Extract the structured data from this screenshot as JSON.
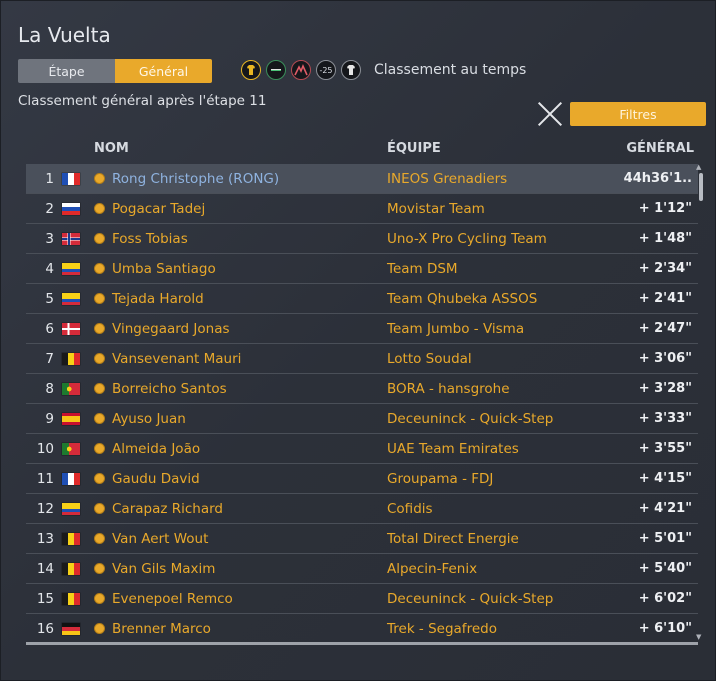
{
  "title": "La Vuelta",
  "segment": {
    "etape": "Étape",
    "general": "Général",
    "selected": "general"
  },
  "icons": [
    {
      "name": "yellow-jersey-icon",
      "color": "#e8b623"
    },
    {
      "name": "green-jersey-icon",
      "color": "#3a8f5a"
    },
    {
      "name": "mountain-jersey-icon",
      "color": "#b44a52"
    },
    {
      "name": "young-rider-icon",
      "text": "-25"
    },
    {
      "name": "team-jersey-icon",
      "color": "#e5e5e5"
    }
  ],
  "classification_label": "Classement au temps",
  "subtitle": "Classement général après l'étape 11",
  "filters_label": "Filtres",
  "columns": {
    "nom": "NOM",
    "equipe": "ÉQUIPE",
    "general": "GÉNÉRAL"
  },
  "rows": [
    {
      "rank": "1",
      "flag": "fr",
      "name": "Rong Christophe (RONG)",
      "team": "INEOS Grenadiers",
      "gap": "44h36'1..",
      "selected": true
    },
    {
      "rank": "2",
      "flag": "si",
      "name": "Pogacar Tadej",
      "team": "Movistar Team",
      "gap": "+ 1'12\""
    },
    {
      "rank": "3",
      "flag": "no",
      "name": "Foss Tobias",
      "team": "Uno-X Pro Cycling Team",
      "gap": "+ 1'48\""
    },
    {
      "rank": "4",
      "flag": "co",
      "name": "Umba Santiago",
      "team": "Team DSM",
      "gap": "+ 2'34\""
    },
    {
      "rank": "5",
      "flag": "co",
      "name": "Tejada Harold",
      "team": "Team Qhubeka ASSOS",
      "gap": "+ 2'41\""
    },
    {
      "rank": "6",
      "flag": "dk",
      "name": "Vingegaard Jonas",
      "team": "Team Jumbo - Visma",
      "gap": "+ 2'47\""
    },
    {
      "rank": "7",
      "flag": "be",
      "name": "Vansevenant Mauri",
      "team": "Lotto Soudal",
      "gap": "+ 3'06\""
    },
    {
      "rank": "8",
      "flag": "pt",
      "name": "Borreicho Santos",
      "team": "BORA - hansgrohe",
      "gap": "+ 3'28\""
    },
    {
      "rank": "9",
      "flag": "es",
      "name": "Ayuso Juan",
      "team": "Deceuninck - Quick-Step",
      "gap": "+ 3'33\""
    },
    {
      "rank": "10",
      "flag": "pt",
      "name": "Almeida João",
      "team": "UAE Team Emirates",
      "gap": "+ 3'55\""
    },
    {
      "rank": "11",
      "flag": "fr",
      "name": "Gaudu David",
      "team": "Groupama - FDJ",
      "gap": "+ 4'15\""
    },
    {
      "rank": "12",
      "flag": "ec",
      "name": "Carapaz Richard",
      "team": "Cofidis",
      "gap": "+ 4'21\""
    },
    {
      "rank": "13",
      "flag": "be",
      "name": "Van Aert Wout",
      "team": "Total Direct Energie",
      "gap": "+ 5'01\""
    },
    {
      "rank": "14",
      "flag": "be",
      "name": "Van Gils Maxim",
      "team": "Alpecin-Fenix",
      "gap": "+ 5'40\""
    },
    {
      "rank": "15",
      "flag": "be",
      "name": "Evenepoel Remco",
      "team": "Deceuninck - Quick-Step",
      "gap": "+ 6'02\""
    },
    {
      "rank": "16",
      "flag": "de",
      "name": "Brenner Marco",
      "team": "Trek - Segafredo",
      "gap": "+ 6'10\""
    }
  ],
  "colors": {
    "accent": "#e9a92b",
    "selected_name": "#8fb3e0",
    "background": "#2c3038"
  }
}
